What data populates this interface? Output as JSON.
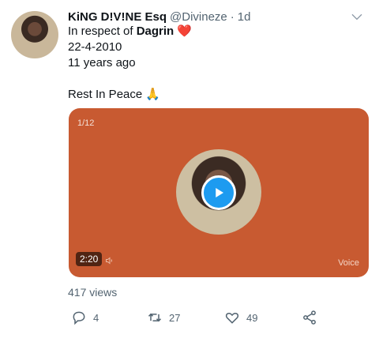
{
  "tweet": {
    "author_name": "KiNG D!V!NE Esq",
    "handle": "@Divineze",
    "separator": "·",
    "time": "1d",
    "lines": {
      "prefix": "In respect of ",
      "subject": "Dagrin",
      "heart": "❤️",
      "date": "22-4-2010",
      "ago": "11 years ago",
      "closing": "Rest In Peace 🙏"
    }
  },
  "media": {
    "counter": "1/12",
    "duration": "2:20",
    "label": "Voice",
    "background_color": "#c85a31",
    "play_color": "#1d9bf0"
  },
  "stats": {
    "views": "417 views",
    "replies": "4",
    "retweets": "27",
    "likes": "49"
  },
  "icons": [
    "chevron-down-icon",
    "play-icon",
    "speaker-icon",
    "reply-icon",
    "retweet-icon",
    "like-icon",
    "share-icon"
  ]
}
